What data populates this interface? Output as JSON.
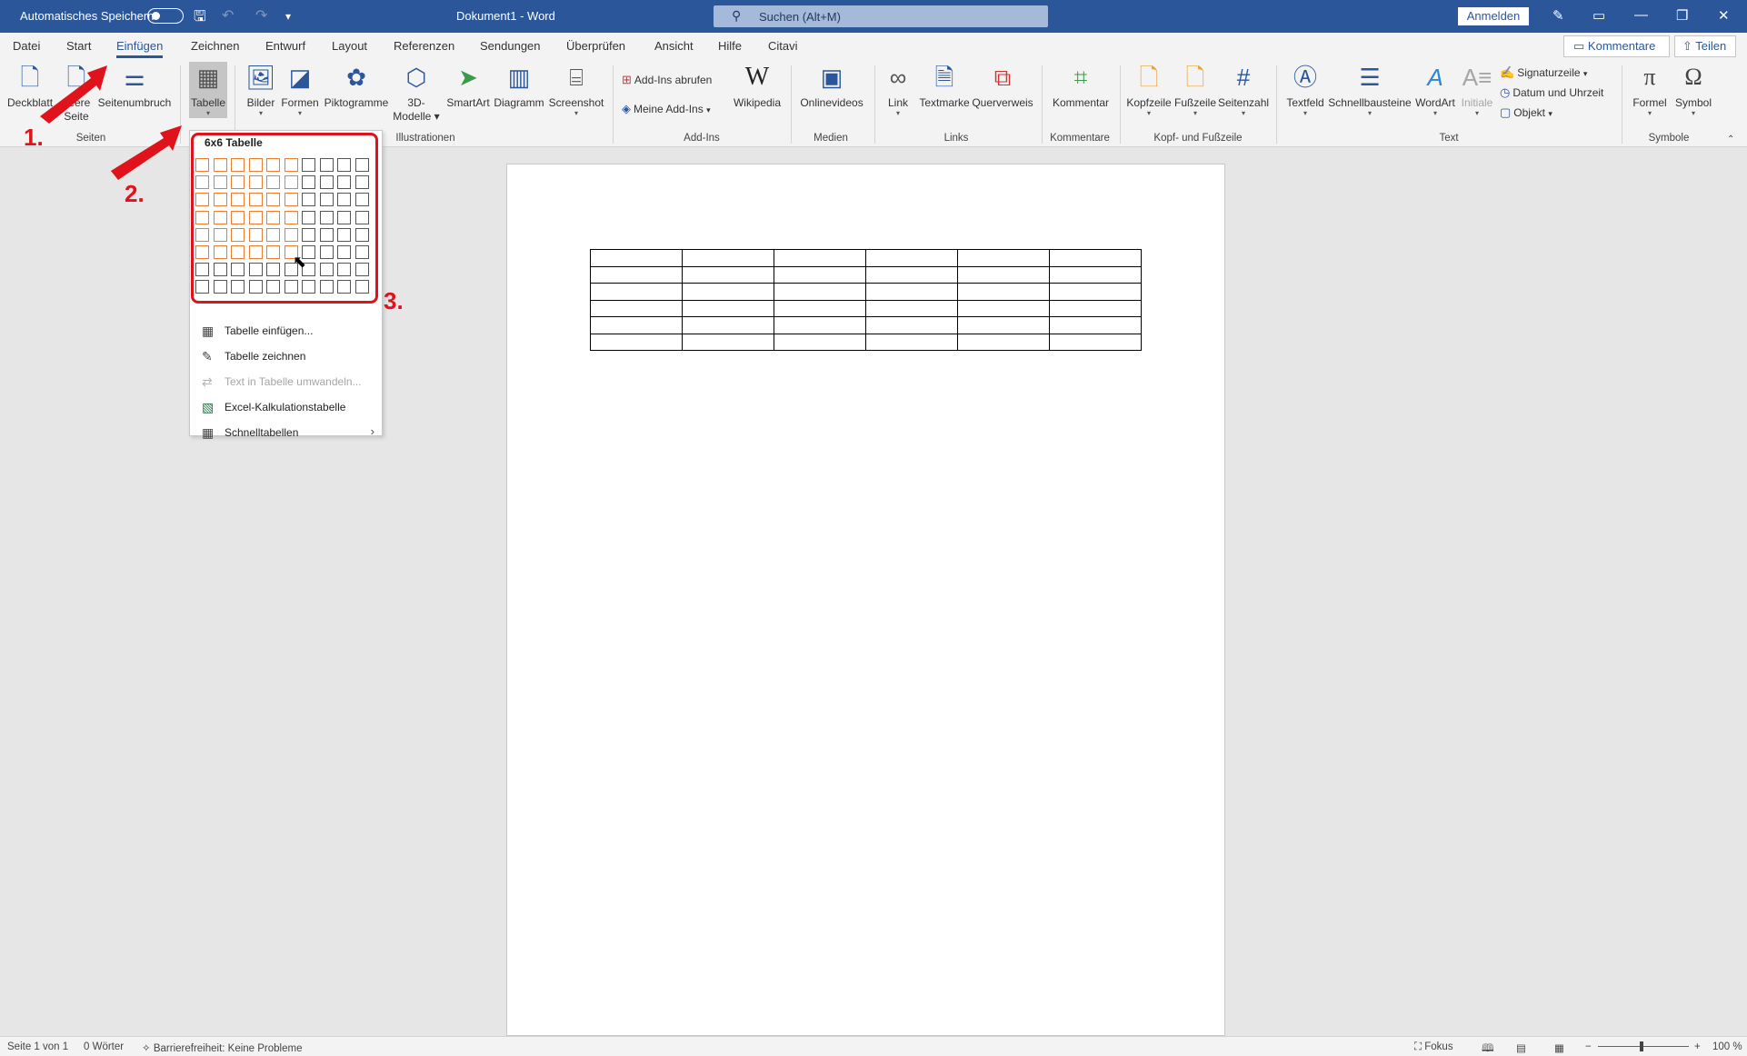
{
  "titlebar": {
    "autosave_label": "Automatisches Speichern",
    "doc_title": "Dokument1 - Word",
    "search_placeholder": "Suchen (Alt+M)",
    "signin_label": "Anmelden"
  },
  "menu_tabs": [
    "Datei",
    "Start",
    "Einfügen",
    "Zeichnen",
    "Entwurf",
    "Layout",
    "Referenzen",
    "Sendungen",
    "Überprüfen",
    "Ansicht",
    "Hilfe",
    "Citavi"
  ],
  "active_tab": "Einfügen",
  "header_buttons": {
    "comments": "Kommentare",
    "share": "Teilen"
  },
  "ribbon": {
    "seiten": {
      "deckblatt": "Deckblatt",
      "leere_seite_1": "Leere",
      "leere_seite_2": "Seite",
      "seitenumbruch": "Seitenumbruch",
      "group": "Seiten"
    },
    "tabellen": {
      "tabelle": "Tabelle"
    },
    "illustrationen": {
      "bilder": "Bilder",
      "formen": "Formen",
      "piktogramme": "Piktogramme",
      "modelle_1": "3D-",
      "modelle_2": "Modelle",
      "smartart": "SmartArt",
      "diagramm": "Diagramm",
      "screenshot": "Screenshot",
      "group": "Illustrationen"
    },
    "addins": {
      "abrufen": "Add-Ins abrufen",
      "meine": "Meine Add-Ins",
      "wikipedia": "Wikipedia",
      "group": "Add-Ins"
    },
    "medien": {
      "onlinevideos": "Onlinevideos",
      "group": "Medien"
    },
    "links": {
      "link": "Link",
      "textmarke": "Textmarke",
      "querverweis": "Querverweis",
      "group": "Links"
    },
    "kommentare": {
      "kommentar": "Kommentar",
      "group": "Kommentare"
    },
    "kopf": {
      "kopfzeile": "Kopfzeile",
      "fusszeile": "Fußzeile",
      "seitenzahl": "Seitenzahl",
      "group": "Kopf- und Fußzeile"
    },
    "text": {
      "textfeld": "Textfeld",
      "schnellbausteine": "Schnellbausteine",
      "wordart": "WordArt",
      "initiale": "Initiale",
      "signaturzeile": "Signaturzeile",
      "datum": "Datum und Uhrzeit",
      "objekt": "Objekt",
      "group": "Text"
    },
    "symbole": {
      "formel": "Formel",
      "symbol": "Symbol",
      "group": "Symbole"
    }
  },
  "dropdown": {
    "title": "6x6 Tabelle",
    "grid_cols": 10,
    "grid_rows": 8,
    "selected_cols": 6,
    "selected_rows": 6,
    "items": [
      {
        "label": "Tabelle einfügen...",
        "icon": "table-icon",
        "disabled": false
      },
      {
        "label": "Tabelle zeichnen",
        "icon": "draw-table-icon",
        "disabled": false
      },
      {
        "label": "Text in Tabelle umwandeln...",
        "icon": "convert-text-icon",
        "disabled": true
      },
      {
        "label": "Excel-Kalkulationstabelle",
        "icon": "excel-icon",
        "disabled": false
      },
      {
        "label": "Schnelltabellen",
        "icon": "quick-table-icon",
        "disabled": false
      }
    ]
  },
  "document": {
    "table_rows": 6,
    "table_cols": 6
  },
  "annotations": [
    "1.",
    "2.",
    "3."
  ],
  "statusbar": {
    "page": "Seite 1 von 1",
    "words": "0 Wörter",
    "accessibility": "Barrierefreiheit: Keine Probleme",
    "focus": "Fokus",
    "zoom": "100 %"
  },
  "colors": {
    "brand": "#2b579a",
    "annotation": "#e0131c",
    "grid_selected": "#ed7d31"
  }
}
